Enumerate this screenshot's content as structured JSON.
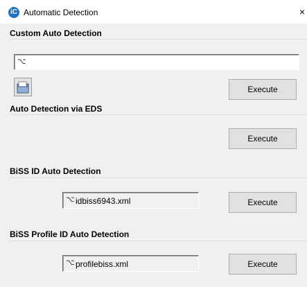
{
  "window": {
    "title": "Automatic Detection",
    "close_glyph": "×",
    "app_icon_text": "iC"
  },
  "sections": [
    {
      "title": "Custom Auto Detection",
      "input_value": "",
      "execute_label": "Execute"
    },
    {
      "title": "Auto Detection via EDS",
      "execute_label": "Execute"
    },
    {
      "title": "BiSS ID Auto Detection",
      "file_value": "idbiss6943.xml",
      "execute_label": "Execute"
    },
    {
      "title": "BiSS Profile ID Auto Detection",
      "file_value": "profilebiss.xml",
      "execute_label": "Execute"
    }
  ],
  "icons": {
    "app": "ic-logo-icon",
    "close": "close-icon",
    "folder": "open-folder-icon",
    "field": "file-placeholder-icon"
  }
}
